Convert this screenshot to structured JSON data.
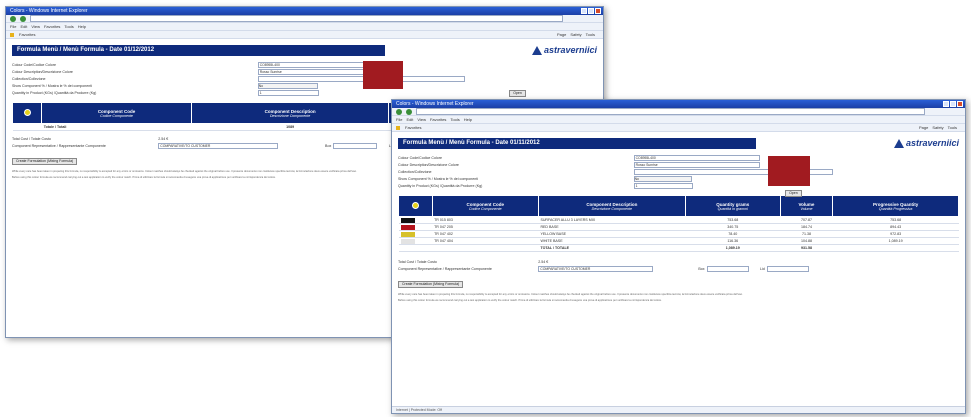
{
  "browser": {
    "title": "Colors - Windows Internet Explorer",
    "menu": [
      "File",
      "Edit",
      "View",
      "Favorites",
      "Tools",
      "Help"
    ],
    "favorites_label": "Favorites",
    "tools_row": [
      "Page",
      "Safety",
      "Tools"
    ]
  },
  "report": {
    "title_back": "Formula Menù / Menù Formula - Date 01/12/2012",
    "title_front": "Formula Menù / Menù Formula - Date 01/11/2012",
    "logo_text": "astraverniici"
  },
  "form": {
    "color_code_label": "Colour Code/Codice Colore",
    "color_code_value": "CO8955L400",
    "color_desc_label": "Colour Description/Descrizione Colore",
    "color_desc_value": "Rosso Sunrise",
    "collection_label": "Collection/Collezione",
    "show_comp_label": "Show Component % / Mostra le % dei componenti",
    "show_comp_value": "No",
    "qty_label": "Quantity in Product (KGs) /Quantità da Produrre (Kg)",
    "qty_value": "1",
    "open_button": "Open"
  },
  "swatch_color": "#a11b20",
  "accent_color": "#0e2a7c",
  "table": {
    "headers": [
      {
        "main": "Component Code",
        "sub": "Codice Componente"
      },
      {
        "main": "Component Description",
        "sub": "Descrizione Componente"
      },
      {
        "main": "Quantity grams",
        "sub": "Quantità in grammi"
      },
      {
        "main": "Volume",
        "sub": "Volume"
      },
      {
        "main": "Progressive Quantity",
        "sub": "Quantità Progressiva"
      }
    ],
    "rows": [
      {
        "chip": "#111111",
        "code": "TR 015 803",
        "desc": "SURFACER ALLU 3 LAYERS MIX",
        "qty": "753.68",
        "vol": "707.87",
        "prog": "753.68"
      },
      {
        "chip": "#b4121b",
        "code": "TR 047 205",
        "desc": "RED BASE",
        "qty": "340.75",
        "vol": "184.74",
        "prog": "894.43"
      },
      {
        "chip": "#d7c12a",
        "code": "TR 047 402",
        "desc": "YELLOW BASE",
        "qty": "78.40",
        "vol": "71.38",
        "prog": "972.83"
      },
      {
        "chip": "#e3e3e3",
        "code": "TR 047 404",
        "desc": "WHITE BASE",
        "qty": "116.36",
        "vol": "104.88",
        "prog": "1,089.19"
      }
    ],
    "total_label": "TOTAL / TOTALE",
    "total_qty": "1,089.19",
    "total_vol": "931.58",
    "back_total_label": "Totale / Totali",
    "back_total_cols": [
      "1089",
      "1089"
    ]
  },
  "footer": {
    "total_cost_label": "Total Cost / Totale Costo",
    "total_cost_value": "2.54 €",
    "comp_label": "Component Representative / Rappresentante Componente",
    "comp_value": "COMPARATIVE/TO CUSTOMER",
    "box_label": "Box",
    "lid_label": "Lid",
    "create_button": "Create Formulation (Mixing Formula)",
    "fine_print": "While every care has been taken in preparing this formula, no responsibility is accepted for any errors or omissions. Colour matches should always be checked against the original before use. Il presente documento non costituisce specifica tecnica; la formulazione deve essere verificata prima dell'uso.",
    "fine_print_2": "Before using this colour formula we recommend carrying out a test application to verify the colour match. Prima di utilizzare la formula si raccomanda di eseguire una prova di applicazione per verificare la corrispondenza del colore."
  },
  "status_text": "Internet | Protected Mode: Off"
}
